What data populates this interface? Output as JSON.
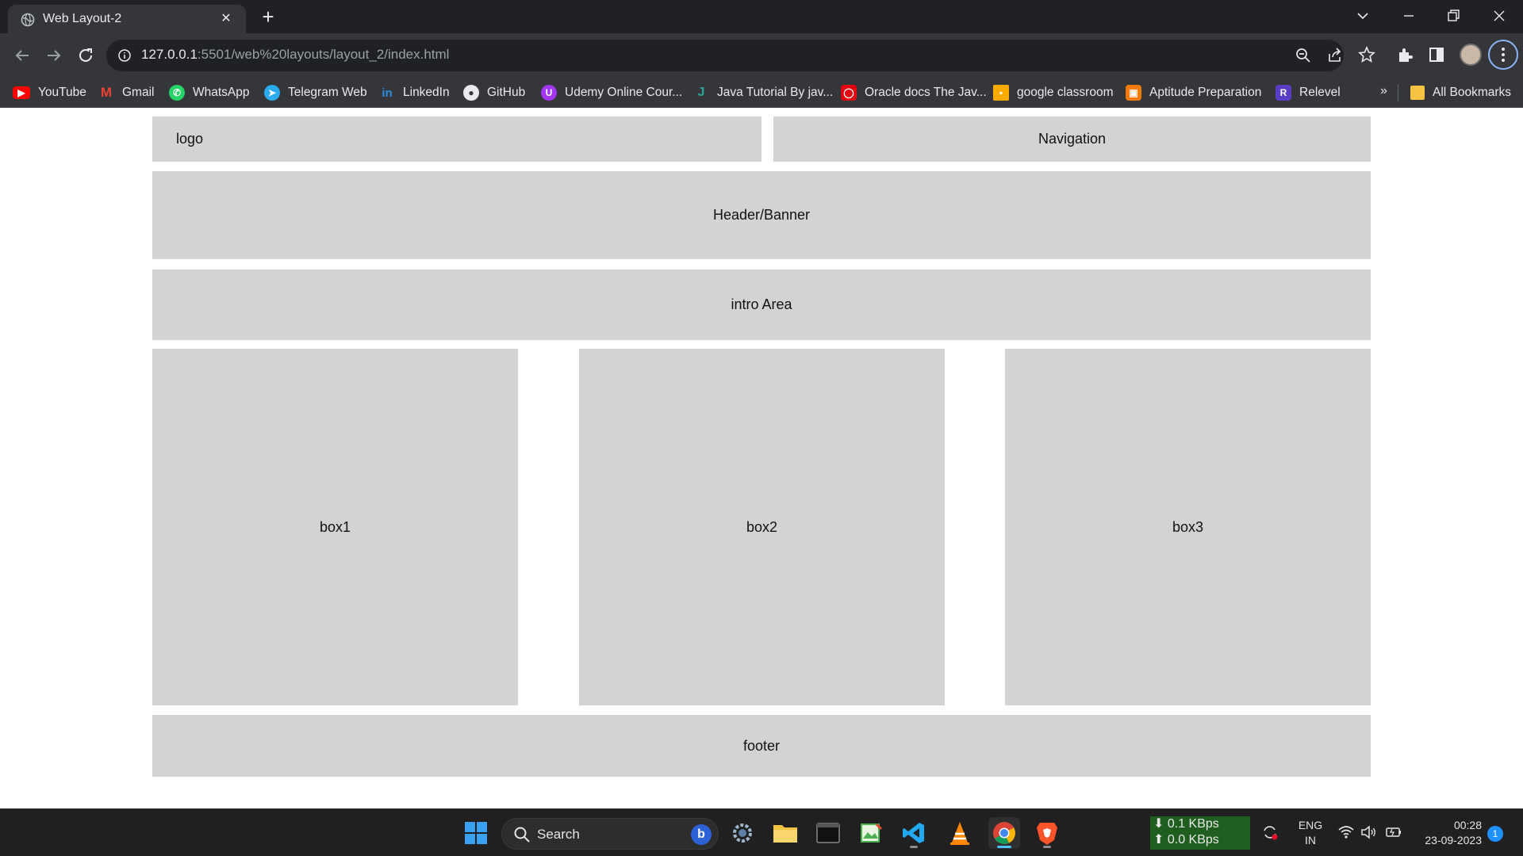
{
  "browser": {
    "tab_title": "Web Layout-2",
    "url_host": "127.0.0.1",
    "url_rest": ":5501/web%20layouts/layout_2/index.html"
  },
  "bookmarks": [
    {
      "label": "YouTube",
      "icon": "youtube-icon",
      "color": "#ff0000"
    },
    {
      "label": "Gmail",
      "icon": "gmail-icon",
      "color": "#ea4335"
    },
    {
      "label": "WhatsApp",
      "icon": "whatsapp-icon",
      "color": "#25d366"
    },
    {
      "label": "Telegram Web",
      "icon": "telegram-icon",
      "color": "#2aabee"
    },
    {
      "label": "LinkedIn",
      "icon": "linkedin-icon",
      "color": "#0a66c2"
    },
    {
      "label": "GitHub",
      "icon": "github-icon",
      "color": "#ffffff"
    },
    {
      "label": "Udemy Online Cour...",
      "icon": "udemy-icon",
      "color": "#a435f0"
    },
    {
      "label": "Java Tutorial By jav...",
      "icon": "javatpoint-icon",
      "color": "#26a69a"
    },
    {
      "label": "Oracle docs The Jav...",
      "icon": "oracle-icon",
      "color": "#e4000f"
    },
    {
      "label": "google classroom",
      "icon": "classroom-icon",
      "color": "#f9ab00"
    },
    {
      "label": "Aptitude Preparation",
      "icon": "aptitude-icon",
      "color": "#f57c00"
    },
    {
      "label": "Relevel",
      "icon": "relevel-icon",
      "color": "#5b3cc4"
    }
  ],
  "bookmarks_more": "»",
  "all_bookmarks": "All Bookmarks",
  "layout": {
    "logo": "logo",
    "navigation": "Navigation",
    "header": "Header/Banner",
    "intro": "intro Area",
    "box1": "box1",
    "box2": "box2",
    "box3": "box3",
    "footer": "footer"
  },
  "taskbar": {
    "search_placeholder": "Search",
    "net_down": "0.1 KBps",
    "net_up": "0.0 KBps",
    "lang_line1": "ENG",
    "lang_line2": "IN",
    "time": "00:28",
    "date": "23-09-2023",
    "notification_count": "1"
  }
}
